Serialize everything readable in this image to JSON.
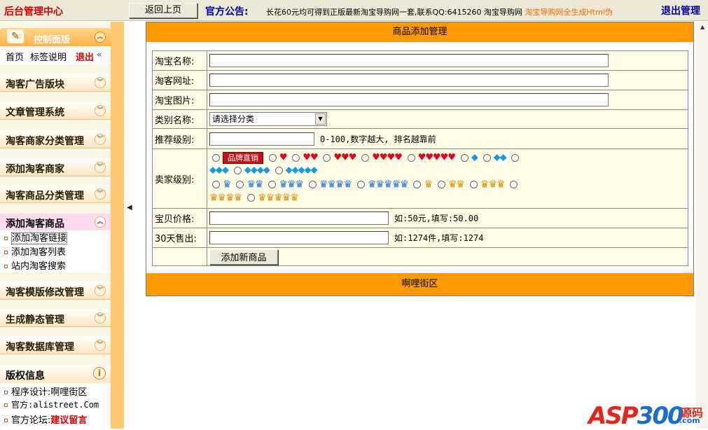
{
  "header": {
    "app_title": "后台管理中心",
    "back_button": "返回上页",
    "notice_label": "官方公告:",
    "notice_text": "长花60元均可得到正版最新淘宝导购网一套,联系QQ:6415260 淘宝导购网",
    "notice_highlight": "淘宝导购网全生成Html伪",
    "logout": "退出管理"
  },
  "sidebar": {
    "control_panel": {
      "title": "控制面版",
      "home": "首页",
      "tags": "标签说明",
      "quit": "退出",
      "collapse": "«"
    },
    "sections": [
      {
        "label": "淘客广告版块"
      },
      {
        "label": "文章管理系统"
      },
      {
        "label": "淘客商家分类管理"
      },
      {
        "label": "添加淘客商家"
      },
      {
        "label": "淘客商品分类管理"
      }
    ],
    "active_section": {
      "label": "添加淘客商品",
      "items": [
        "添加淘客链接",
        "添加淘客列表",
        "站内淘客搜索"
      ]
    },
    "sections_after": [
      {
        "label": "淘客模版修改管理"
      },
      {
        "label": "生成静态管理"
      },
      {
        "label": "淘客数据库管理"
      }
    ],
    "copyright": {
      "title": "版权信息",
      "designer": "程序设计:啊哩街区",
      "site": "官方:alistreet.Com",
      "forum_prefix": "官方论坛:",
      "forum_link": "建议留言"
    }
  },
  "panel": {
    "title": "商品添加管理",
    "footer": "啊哩街区",
    "fields": {
      "name_label": "淘宝名称:",
      "url_label": "淘客网址:",
      "image_label": "淘宝图片:",
      "category_label": "类别名称:",
      "category_value": "请选择分类",
      "rank_label": "推荐级别:",
      "rank_hint": "0-100,数字越大, 排名越靠前",
      "seller_label": "卖家级别:",
      "brand_badge": "品牌直销",
      "price_label": "宝贝价格:",
      "price_hint": "如:50元,填写:50.00",
      "sales_label": "30天售出:",
      "sales_hint": "如:1274件,填写:1274",
      "submit": "添加新商品"
    }
  },
  "watermark": {
    "asp": "ASP",
    "num": "300",
    "cn": "源码",
    "com": ".com"
  },
  "colors": {
    "accent_orange": "#ff9a00",
    "title_red": "#d40000",
    "notice_blue": "#0000a0"
  }
}
